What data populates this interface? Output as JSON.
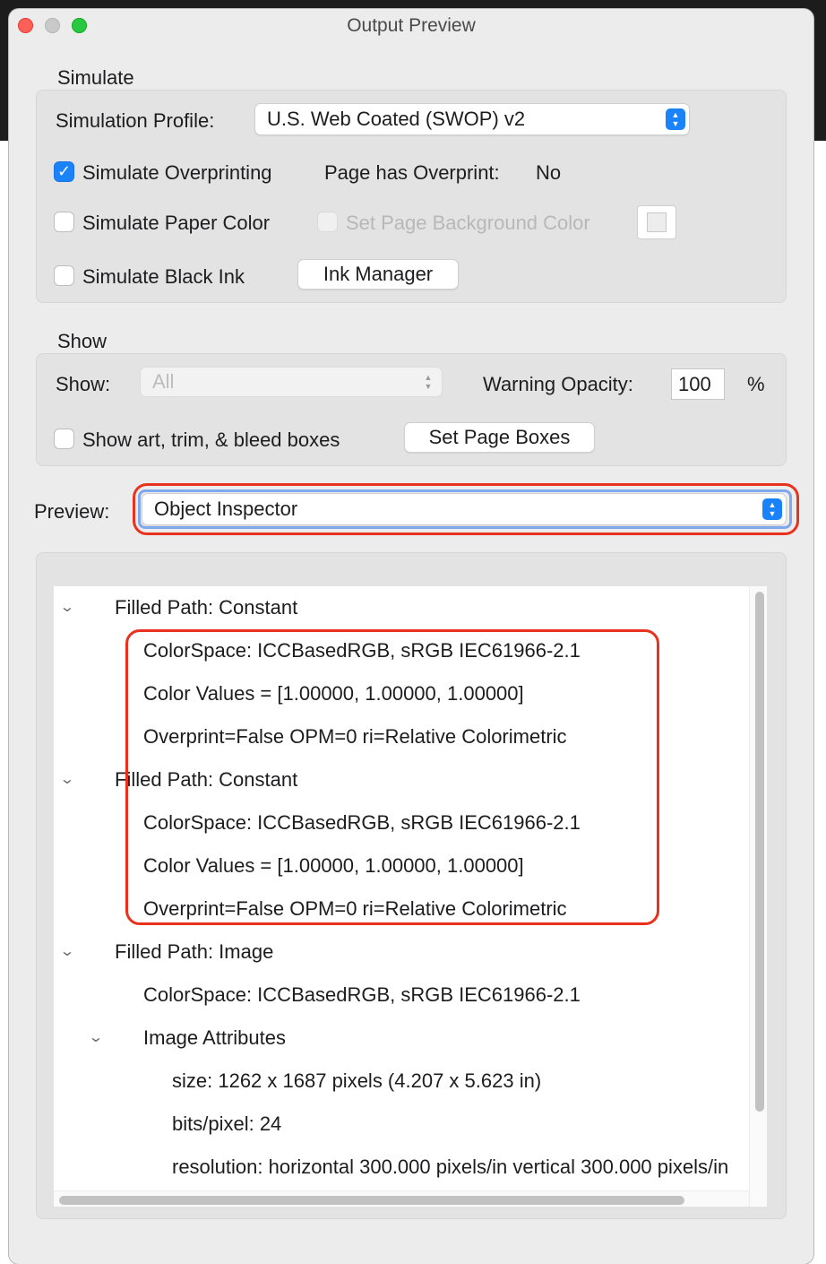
{
  "window": {
    "title": "Output Preview"
  },
  "simulate": {
    "section_label": "Simulate",
    "profile_label": "Simulation Profile:",
    "profile_value": "U.S. Web Coated (SWOP) v2",
    "overprinting_label": "Simulate Overprinting",
    "overprinting_checked": true,
    "page_overprint_label": "Page has Overprint:",
    "page_overprint_value": "No",
    "paper_color_label": "Simulate Paper Color",
    "page_bg_label": "Set Page Background Color",
    "black_ink_label": "Simulate Black Ink",
    "ink_manager_label": "Ink Manager"
  },
  "show": {
    "section_label": "Show",
    "show_label": "Show:",
    "show_value": "All",
    "warning_opacity_label": "Warning Opacity:",
    "warning_opacity_value": "100",
    "percent": "%",
    "boxes_label": "Show art, trim, & bleed boxes",
    "set_page_boxes_label": "Set Page Boxes"
  },
  "preview": {
    "label": "Preview:",
    "value": "Object Inspector"
  },
  "tree": {
    "chevron": "⌄",
    "items": [
      {
        "text": "Filled Path: Constant"
      },
      {
        "text": "ColorSpace: ICCBasedRGB, sRGB IEC61966-2.1"
      },
      {
        "text": "Color Values = [1.00000, 1.00000, 1.00000]"
      },
      {
        "text": "Overprint=False OPM=0 ri=Relative Colorimetric"
      },
      {
        "text": "Filled Path: Constant"
      },
      {
        "text": "ColorSpace: ICCBasedRGB, sRGB IEC61966-2.1"
      },
      {
        "text": "Color Values = [1.00000, 1.00000, 1.00000]"
      },
      {
        "text": "Overprint=False OPM=0 ri=Relative Colorimetric"
      },
      {
        "text": "Filled Path: Image"
      },
      {
        "text": "ColorSpace: ICCBasedRGB, sRGB IEC61966-2.1"
      },
      {
        "text": "Image Attributes"
      },
      {
        "text": "size: 1262 x 1687 pixels (4.207 x 5.623 in)"
      },
      {
        "text": "bits/pixel: 24"
      },
      {
        "text": "resolution: horizontal 300.000 pixels/in vertical 300.000 pixels/in"
      }
    ]
  },
  "colors": {
    "accent": "#1a82fb",
    "annotation_red": "#e8321e"
  }
}
